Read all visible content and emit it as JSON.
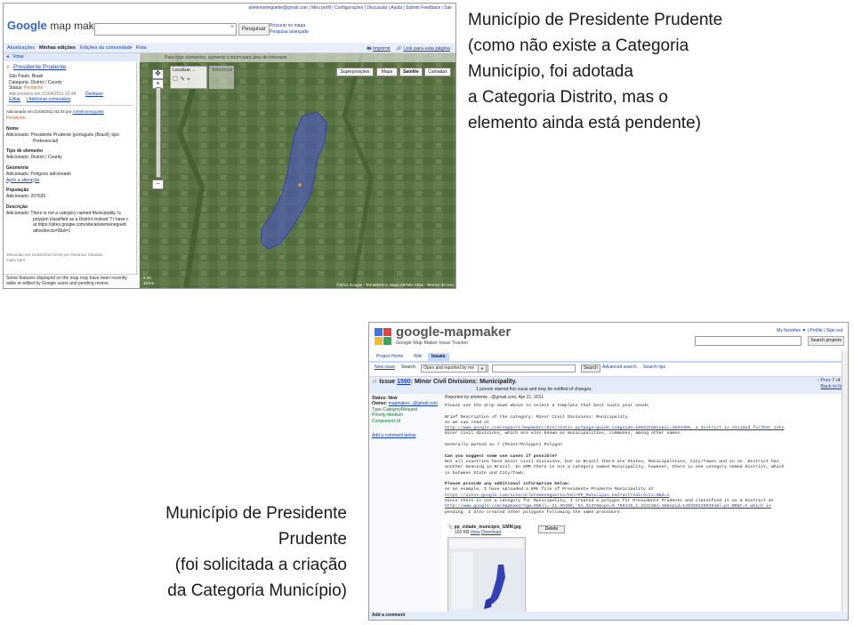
{
  "caption_top": [
    "Município de Presidente Prudente",
    "(como não existe a Categoria",
    "Município, foi adotada",
    "a Categoria Distrito, mas o",
    "elemento ainda está pendente)"
  ],
  "caption_bottom": [
    "Município de Presidente",
    "Prudente",
    "(foi solicitada a criação",
    "da Categoria Município)"
  ],
  "mapmaker": {
    "user_links": "arletemeneguette@gmail.com | Meu perfil | Configurações | Discussão | Ajuda | Submit Feedback | Sair",
    "logo_word": "Google",
    "logo_product": "map maker",
    "search_button": "Pesquisar",
    "search_link_1": "Procurar no mapa",
    "search_link_2": "Pesquisa avançada",
    "tabs": [
      "Atualizações",
      "Minhas edições",
      "Edições da comunidade",
      "Rota"
    ],
    "print_link": "Imprimir",
    "link_link": "Link para esta página",
    "panel_header": "Votar",
    "feature": {
      "name": "Presidente Prudente",
      "location": "São Paulo, Brasil",
      "category": "Categoria: District / County",
      "status_label": "Status: ",
      "status_value": "Pendente",
      "added": "Adicionados em 21/04/2011 02:44",
      "undo": "Desfazer",
      "edit": "Editar",
      "add_comment": "| Adicionar comentário",
      "added_by_prefix": "Adicionado em 21/04/2011 02:44 por ",
      "added_by_user": "Arletemeneguette",
      "pending": "Pendente",
      "name_title": "Nome",
      "name_added": "Adicionado: Presidente Prudente (português (Brasil); tipo:",
      "name_added_2": "Preferencial)",
      "type_title": "Tipo de elemento",
      "type_added": "Adicionado: District / County",
      "geom_title": "Geometria",
      "geom_added": "Adicionado: Polígono adicionado",
      "geom_link": "Após a alteração",
      "pop_title": "População",
      "pop_added": "Adicionado: 207625",
      "desc_title": "Descrição",
      "desc_1": "Adicionado: There is not a category named Municipality. Is",
      "desc_2": "polygon classified as a District instead ? I have c",
      "desc_3": "at https://sites.google.com/site/arletemeneguett",
      "desc_4": "attredirects=0&d=1",
      "comment_1": "Tamonatu em 21/04/2011 02:54 por Geranios Cândido",
      "comment_2": "muito bem"
    },
    "footer": "Some features displayed on the map may have been recently adde or edited by Google users and pending review.",
    "map_tip": "Para criar elementos, aumente o zoom para área de interesse",
    "map_types": [
      "Superposições",
      "Mapa",
      "Satélite",
      "Camadas"
    ],
    "toolbox_label": "Localizar ...",
    "toolbox2_label": "Selecionar",
    "scale_1": "5 mi",
    "scale_2": "10 km",
    "copyright": "©2011 Google - TerraMetrics, MapLink/Tele Atlas - Termos de Uso"
  },
  "tracker": {
    "logo": "google-mapmaker",
    "subtitle": "Google Map Maker Issue Tracker",
    "top_links": "My favorites ▼ | Profile | Sign out",
    "search_projects": "Search projects",
    "tabs": [
      "Project Home",
      "Wiki",
      "Issues"
    ],
    "new_issue": "New issue",
    "search_label": "Search",
    "search_scope": "Open and reported by me",
    "search_btn": "Search",
    "adv_search": "Advanced search",
    "search_tips": "Search tips",
    "issue_prefix": "Issue ",
    "issue_number": "1590",
    "issue_title": ": Minor Civil Divisions: Municipality.",
    "starred": "1 person starred this issue and may be notified of changes.",
    "prev": "‹ Prev",
    "count": "7 of 7",
    "back": "Back to list",
    "meta": {
      "status": "Status: New",
      "owner_label": "Owner: ",
      "owner": "mapmaker...@gmail.com",
      "type": "Type-CategoryRequest",
      "priority": "Priority-Medium",
      "component": "Component-UI",
      "add_comment_below": "Add a comment below"
    },
    "reported_by": "Reported by arleteme...@gmail.com, Apr 21, 2011",
    "body": [
      "Please use the drop down above to select a template that best suits your needs",
      "",
      "Brief Description of the category: Minor Civil Divisions: Municipality.",
      "As we can read at",
      "http://www.google.com/support/mapmaker/bin/static.py?page=guide.cs&guide=1094315&topic=1094480, a district is divided further into",
      "minor civil divisions, which are also known as municipalities, communes, among other names.",
      "",
      "Generally marked as ? (Point/Polygon) Polygon",
      "",
      "Can you suggest some use cases if possible?",
      "Not all countries have minor civil divisions, but in Brazil there are States, Municipalities, City/Towns and so on. District has",
      "another meaning in Brazil. In GMM there is not a category named Municipality, however, there is one category named District, which",
      "is between State and City/Town.",
      "",
      "Please provide any additional information below:",
      "As an example, I have uploaded a KML file of Presidente Prudente Municipality at",
      "https://sites.google.com/site/arletemeneguette/kml/PP_Municipio.kml?attredirects=0&d=1",
      "Since there is not a category for Municipality, I created a polygon for Presidente Prudente and classified it as a District at",
      "http://www.google.com/mapmaker?gw=30&ll=-21.95300,-51.31376&spn=0.706115,1.22223&z=10&vpid=1303392260394&l=pt-BR&t=h which is",
      "pending. I also created other polygons following the same procedure."
    ],
    "attachment_name": "pp_cidade_municipio_GMM.jpg",
    "attachment_size": "102 KB",
    "attachment_view": "View",
    "attachment_download": "Download",
    "delete_btn": "Delete",
    "add_comment": "Add a comment"
  },
  "colors": {
    "link": "#1a3fa8",
    "pending": "#d4601a",
    "map_green": "#5c7344",
    "polygon": "#4a55c8",
    "tracker_band": "#e5ecf9"
  }
}
